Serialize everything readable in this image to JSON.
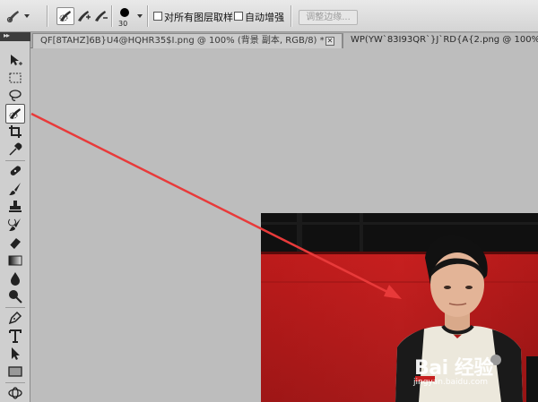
{
  "options_bar": {
    "brush_size": "30",
    "sample_all_layers_label": "对所有图层取样",
    "sample_all_layers_checked": false,
    "auto_enhance_label": "自动增强",
    "auto_enhance_checked": false,
    "refine_edge_label": "调整边缘..."
  },
  "panel_collapse_glyph": "▸▸",
  "tabs": [
    {
      "label": "QF[8TAHZ]6B}U4@HQHR35$I.png @ 100% (背景 副本, RGB/8) *",
      "active": true
    },
    {
      "label": "WP(YW`83I93QR`}J`RD{A{2.png @ 100%(RG",
      "active": false
    }
  ],
  "tab_close_glyph": "✕",
  "toolbox": {
    "selected_tool": "quick-selection-tool",
    "tools": [
      "move-tool",
      "marquee-tool",
      "lasso-tool",
      "quick-selection-tool",
      "crop-tool",
      "eyedropper-tool",
      "healing-brush-tool",
      "brush-tool",
      "clone-stamp-tool",
      "history-brush-tool",
      "eraser-tool",
      "gradient-tool",
      "blur-tool",
      "dodge-tool",
      "pen-tool",
      "type-tool",
      "path-selection-tool",
      "rectangle-tool",
      "3d-rotate-tool"
    ]
  },
  "canvas": {
    "watermark_main": "Bai 经验",
    "watermark_sub": "jingyan.baidu.com"
  },
  "colors": {
    "arrow": "#e83a3a",
    "wall_red": "#b51a1a",
    "shirt": "#ece8dc"
  }
}
